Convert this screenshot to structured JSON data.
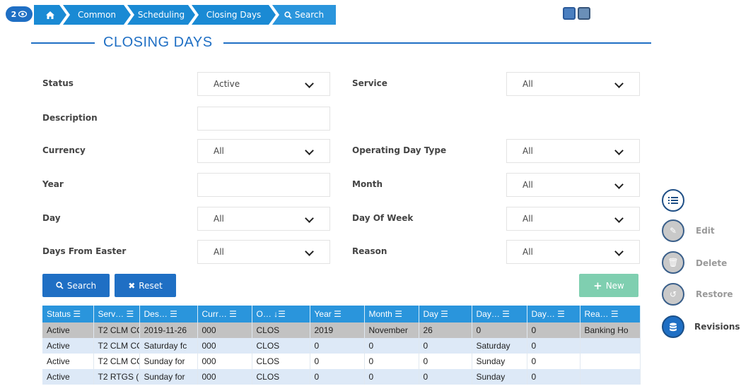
{
  "badge": {
    "count": "2",
    "icon": "eye-icon"
  },
  "breadcrumb": {
    "home_icon": "home-icon",
    "items": [
      "Common",
      "Scheduling",
      "Closing Days"
    ],
    "search_label": "Search"
  },
  "toolbar": {
    "icons": [
      "save-icon",
      "print-icon"
    ]
  },
  "page": {
    "title": "CLOSING DAYS"
  },
  "form": {
    "status": {
      "label": "Status",
      "value": "Active"
    },
    "service": {
      "label": "Service",
      "value": "All"
    },
    "description": {
      "label": "Description",
      "value": ""
    },
    "currency": {
      "label": "Currency",
      "value": "All"
    },
    "operating_day_type": {
      "label": "Operating Day Type",
      "value": "All"
    },
    "year": {
      "label": "Year",
      "value": ""
    },
    "month": {
      "label": "Month",
      "value": "All"
    },
    "day": {
      "label": "Day",
      "value": "All"
    },
    "day_of_week": {
      "label": "Day Of Week",
      "value": "All"
    },
    "days_from_easter": {
      "label": "Days From Easter",
      "value": "All"
    },
    "reason": {
      "label": "Reason",
      "value": "All"
    }
  },
  "buttons": {
    "search": "Search",
    "reset": "Reset",
    "new": "New"
  },
  "table": {
    "headers": [
      "Status",
      "Serv…",
      "Des…",
      "Curr…",
      "O…",
      "Year",
      "Month",
      "Day",
      "Day…",
      "Day…",
      "Rea…"
    ],
    "rows": [
      [
        "Active",
        "T2 CLM CC",
        "2019-11-26",
        "000",
        "CLOS",
        "2019",
        "November",
        "26",
        "0",
        "0",
        "Banking Ho"
      ],
      [
        "Active",
        "T2 CLM CC",
        "Saturday fc",
        "000",
        "CLOS",
        "0",
        "0",
        "0",
        "Saturday",
        "0",
        ""
      ],
      [
        "Active",
        "T2 CLM CC",
        "Sunday for",
        "000",
        "CLOS",
        "0",
        "0",
        "0",
        "Sunday",
        "0",
        ""
      ],
      [
        "Active",
        "T2 RTGS (",
        "Sunday for",
        "000",
        "CLOS",
        "0",
        "0",
        "0",
        "Sunday",
        "0",
        ""
      ]
    ]
  },
  "side_actions": {
    "list_icon": "list-icon",
    "edit": "Edit",
    "delete": "Delete",
    "restore": "Restore",
    "revisions": "Revisions"
  },
  "colors": {
    "primary": "#1f6fc4",
    "breadcrumb": "#1a8ad4",
    "new_button": "#7fcfb0",
    "selected_row": "#c2c2c2",
    "alt_row": "#dde9f7"
  }
}
